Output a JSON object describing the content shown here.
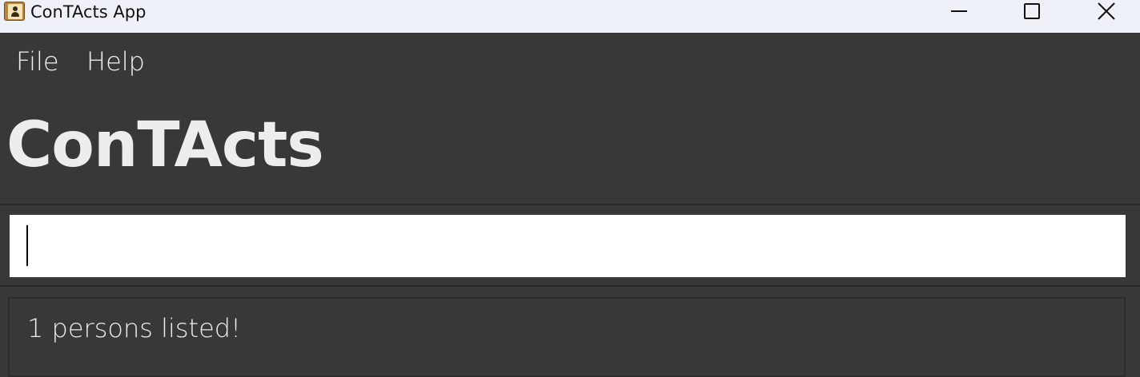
{
  "window": {
    "title": "ConTActs App",
    "icon": "contacts-book-icon",
    "controls": [
      "minimize-icon",
      "maximize-icon",
      "close-icon"
    ]
  },
  "menu": {
    "items": [
      {
        "label": "File"
      },
      {
        "label": "Help"
      }
    ]
  },
  "app": {
    "heading": "ConTActs"
  },
  "command": {
    "value": "",
    "placeholder": ""
  },
  "result": {
    "message": "1 persons listed!"
  },
  "colors": {
    "titlebar_bg": "#eef2f8",
    "app_bg": "#383838",
    "text_light": "#ededed",
    "input_bg": "#ffffff"
  }
}
